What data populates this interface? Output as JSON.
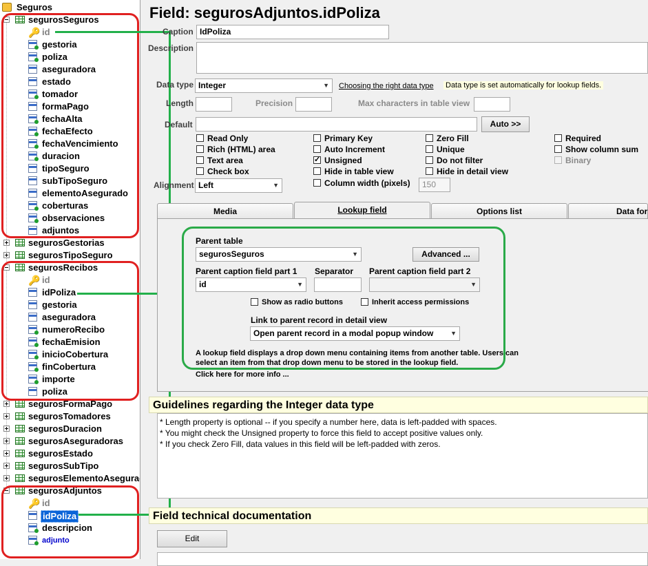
{
  "tree": {
    "root": "Seguros",
    "nodes": [
      {
        "label": "segurosSeguros",
        "kind": "table",
        "expanded": true
      },
      {
        "label": "id",
        "kind": "key"
      },
      {
        "label": "gestoria",
        "kind": "lookup"
      },
      {
        "label": "poliza",
        "kind": "lookup"
      },
      {
        "label": "aseguradora",
        "kind": "field"
      },
      {
        "label": "estado",
        "kind": "field"
      },
      {
        "label": "tomador",
        "kind": "lookup"
      },
      {
        "label": "formaPago",
        "kind": "field"
      },
      {
        "label": "fechaAlta",
        "kind": "lookup"
      },
      {
        "label": "fechaEfecto",
        "kind": "lookup"
      },
      {
        "label": "fechaVencimiento",
        "kind": "lookup"
      },
      {
        "label": "duracion",
        "kind": "lookup"
      },
      {
        "label": "tipoSeguro",
        "kind": "field"
      },
      {
        "label": "subTipoSeguro",
        "kind": "field"
      },
      {
        "label": "elementoAsegurado",
        "kind": "field"
      },
      {
        "label": "coberturas",
        "kind": "lookup"
      },
      {
        "label": "observaciones",
        "kind": "lookup"
      },
      {
        "label": "adjuntos",
        "kind": "field"
      },
      {
        "label": "segurosGestorias",
        "kind": "table",
        "expanded": false
      },
      {
        "label": "segurosTipoSeguro",
        "kind": "table",
        "expanded": false
      },
      {
        "label": "segurosRecibos",
        "kind": "table",
        "expanded": true
      },
      {
        "label": "id",
        "kind": "key"
      },
      {
        "label": "idPoliza",
        "kind": "field"
      },
      {
        "label": "gestoria",
        "kind": "field"
      },
      {
        "label": "aseguradora",
        "kind": "field"
      },
      {
        "label": "numeroRecibo",
        "kind": "lookup"
      },
      {
        "label": "fechaEmision",
        "kind": "lookup"
      },
      {
        "label": "inicioCobertura",
        "kind": "lookup"
      },
      {
        "label": "finCobertura",
        "kind": "lookup"
      },
      {
        "label": "importe",
        "kind": "lookup"
      },
      {
        "label": "poliza",
        "kind": "field"
      },
      {
        "label": "segurosFormaPago",
        "kind": "table",
        "expanded": false
      },
      {
        "label": "segurosTomadores",
        "kind": "table",
        "expanded": false
      },
      {
        "label": "segurosDuracion",
        "kind": "table",
        "expanded": false
      },
      {
        "label": "segurosAseguradoras",
        "kind": "table",
        "expanded": false
      },
      {
        "label": "segurosEstado",
        "kind": "table",
        "expanded": false
      },
      {
        "label": "segurosSubTipo",
        "kind": "table",
        "expanded": false
      },
      {
        "label": "segurosElementoAsegurado",
        "kind": "table",
        "expanded": false
      },
      {
        "label": "segurosAdjuntos",
        "kind": "table",
        "expanded": true
      },
      {
        "label": "id",
        "kind": "key"
      },
      {
        "label": "idPoliza",
        "kind": "field",
        "selected": true
      },
      {
        "label": "descripcion",
        "kind": "lookup"
      },
      {
        "label": "adjunto",
        "kind": "lookup",
        "link": true
      }
    ]
  },
  "field": {
    "title": "Field: segurosAdjuntos.idPoliza",
    "caption_label": "Caption",
    "caption_value": "IdPoliza",
    "description_label": "Description",
    "description_value": "",
    "datatype_label": "Data type",
    "datatype_value": "Integer",
    "datatype_help_link": "Choosing the right data type",
    "datatype_hint": "Data type is set automatically for lookup fields.",
    "length_label": "Length",
    "length_value": "",
    "precision_label": "Precision",
    "precision_value": "",
    "maxchars_label": "Max characters in table view",
    "maxchars_value": "",
    "default_label": "Default",
    "default_value": "",
    "auto_button": "Auto >>",
    "alignment_label": "Alignment",
    "alignment_value": "Left",
    "column_width_value": "150"
  },
  "checkboxes": {
    "read_only": "Read Only",
    "rich_html": "Rich (HTML) area",
    "text_area": "Text area",
    "check_box": "Check box",
    "primary_key": "Primary Key",
    "auto_increment": "Auto Increment",
    "unsigned": "Unsigned",
    "hide_table_view": "Hide in table view",
    "column_width": "Column width (pixels)",
    "zero_fill": "Zero Fill",
    "unique": "Unique",
    "do_not_filter": "Do not filter",
    "hide_detail_view": "Hide in detail view",
    "required": "Required",
    "show_column_sum": "Show column sum",
    "binary": "Binary"
  },
  "tabs": [
    "Media",
    "Lookup field",
    "Options list",
    "Data format"
  ],
  "lookup": {
    "parent_table_label": "Parent table",
    "parent_table_value": "segurosSeguros",
    "advanced_button": "Advanced ...",
    "caption_part1_label": "Parent caption field part 1",
    "caption_part1_value": "id",
    "separator_label": "Separator",
    "separator_value": "",
    "caption_part2_label": "Parent caption field part 2",
    "caption_part2_value": "",
    "radio_buttons": "Show as radio buttons",
    "inherit_permissions": "Inherit access permissions",
    "link_label": "Link to parent record in detail view",
    "link_value": "Open parent record in a modal popup window",
    "description": "A lookup field displays a drop down menu containing items from another table. Users can select an item from that drop down menu to be stored in the lookup field.",
    "more_info": "Click here for more info ..."
  },
  "guidelines": {
    "title": "Guidelines regarding the Integer data type",
    "lines": [
      "* Length property is optional -- if you specify a number here, data is left-padded with spaces.",
      "* You might check the Unsigned property to force this field to accept positive values only.",
      "* If you check Zero Fill, data values in this field will be left-padded with zeros."
    ]
  },
  "techdoc": {
    "title": "Field technical documentation",
    "edit_button": "Edit"
  }
}
